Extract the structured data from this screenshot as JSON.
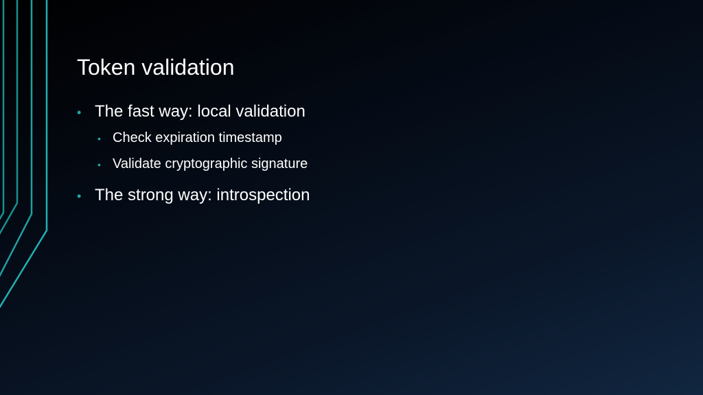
{
  "slide": {
    "title": "Token validation",
    "bullet_glyph": "•",
    "bullets": [
      {
        "text": "The fast way: local validation",
        "sub": [
          {
            "text": "Check expiration timestamp"
          },
          {
            "text": "Validate cryptographic signature"
          }
        ]
      },
      {
        "text": "The strong way: introspection"
      }
    ]
  },
  "colors": {
    "accent": "#1fa8a8",
    "text": "#ffffff",
    "background_dark": "#000000",
    "background_light": "#112640"
  }
}
